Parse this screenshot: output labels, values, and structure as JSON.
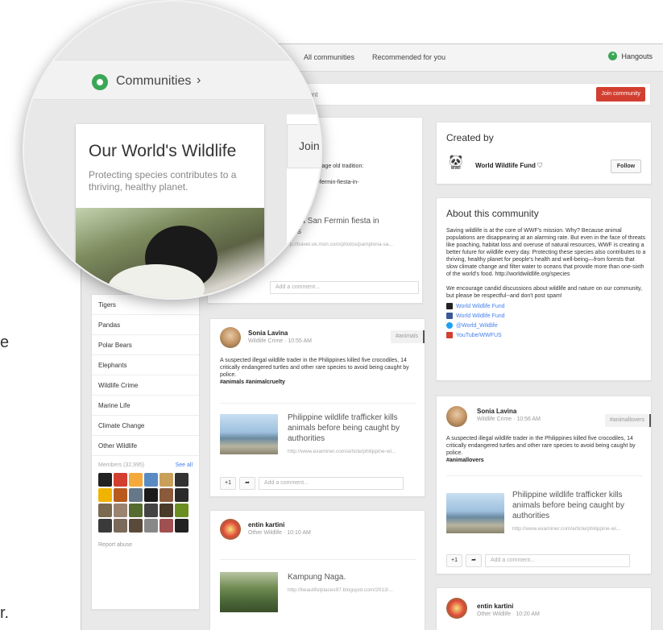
{
  "topbar": {
    "nav_all": "All communities",
    "nav_recommended": "Recommended for you",
    "hangouts": "Hangouts"
  },
  "subbar": {
    "comment_fragment": "mment",
    "join_button": "Join community"
  },
  "lens": {
    "communities_label": "Communities",
    "community_title": "Our World's Wildlife",
    "community_subtitle": "Protecting species contributes to a thriving, healthy planet.",
    "join_fragment": "Join"
  },
  "partial_post": {
    "text_fragment": "quence of this age old tradition:",
    "link_fragment": "mplona-san-fermin-fiesta-in-",
    "title_fragment": "lona San Fermin fiesta in",
    "title_fragment2": "res",
    "url_fragment": "p://travel.uk.msn.com/photos/pamplona-sa...",
    "add_comment": "Add a comment..."
  },
  "left_nav": {
    "items": [
      "Tigers",
      "Pandas",
      "Polar Bears",
      "Elephants",
      "Wildlife Crime",
      "Marine Life",
      "Climate Change",
      "Other Wildlife"
    ],
    "members_label": "Members (32,995)",
    "see_all": "See all",
    "report_abuse": "Report abuse",
    "avatar_colors": [
      "#222222",
      "#d23f31",
      "#f4a93a",
      "#5a8bc3",
      "#c9a05a",
      "#333333",
      "#f0b400",
      "#b85a1e",
      "#667788",
      "#1a1a1a",
      "#8a5a3a",
      "#2a2a2a",
      "#7a6a50",
      "#9a8470",
      "#556b2f",
      "#444444",
      "#4a3a2a",
      "#6b8e23",
      "#3a3a3a",
      "#7b6a5a",
      "#5a4a3a",
      "#888888",
      "#a05050",
      "#222222"
    ]
  },
  "posts": [
    {
      "author": "Sonia Lavina",
      "category": "Wildlife Crime",
      "time": "10:55 AM",
      "tag": "#animals",
      "text": "A suspected illegal wildlife trader in the Philippines killed five crocodiles, 14 critically endangered turtles and other rare species to avoid being caught by police.",
      "hashtags": "#animals  #animalcruelty",
      "link_title": "Philippine wildlife trafficker kills animals before being caught by authorities",
      "link_url": "http://www.examiner.com/article/philippine-wi...",
      "plus_one": "+1",
      "add_comment": "Add a comment..."
    },
    {
      "author": "entin kartini",
      "category": "Other Wildlife",
      "time": "10:10 AM",
      "link_title": "Kampung Naga.",
      "link_url": "http://beautifulplaces97.blogspot.com/2013/..."
    }
  ],
  "created_by": {
    "title": "Created by",
    "name": "World Wildlife Fund",
    "follow": "Follow",
    "logo_text": "WWF"
  },
  "about": {
    "title": "About this community",
    "paragraph1": "Saving wildlife is at the core of WWF's mission. Why? Because animal populations are disappearing at an alarming rate. But even in the face of threats like poaching, habitat loss and overuse of natural resources, WWF is creating a better future for wildlife every day. Protecting these species also contributes to a thriving, healthy planet for people's health and well-being—from forests that slow climate change and filter water to oceans that provide more than one-sixth of the world's food. http://worldwildlife.org/species",
    "paragraph2": "We encourage candid discussions about wildlife and nature on our community, but please be respectful--and don't post spam!",
    "links": [
      {
        "label": "World Wildlife Fund",
        "color": "#222222"
      },
      {
        "label": "World Wildlife Fund",
        "color": "#3b5998"
      },
      {
        "label": "@World_Wildlife",
        "color": "#1da1f2"
      },
      {
        "label": "YouTube/WWFUS",
        "color": "#d23f31"
      }
    ]
  },
  "right_post": {
    "author": "Sonia Lavina",
    "category": "Wildlife Crime",
    "time": "10:56 AM",
    "tag": "#animallovers",
    "text": "A suspected illegal wildlife trader in the Philippines killed five crocodiles, 14 critically endangered turtles and other rare species to avoid being caught by police.",
    "hashtags": "#animallovers",
    "link_title": "Philippine wildlife trafficker kills animals before being caught by authorities",
    "link_url": "http://www.examiner.com/article/philippine-wi...",
    "plus_one": "+1",
    "add_comment": "Add a comment..."
  },
  "right_post2": {
    "author": "entin kartini",
    "category": "Other Wildlife",
    "time": "10:20 AM"
  },
  "left_edge_fragments": [
    "e",
    "r."
  ]
}
